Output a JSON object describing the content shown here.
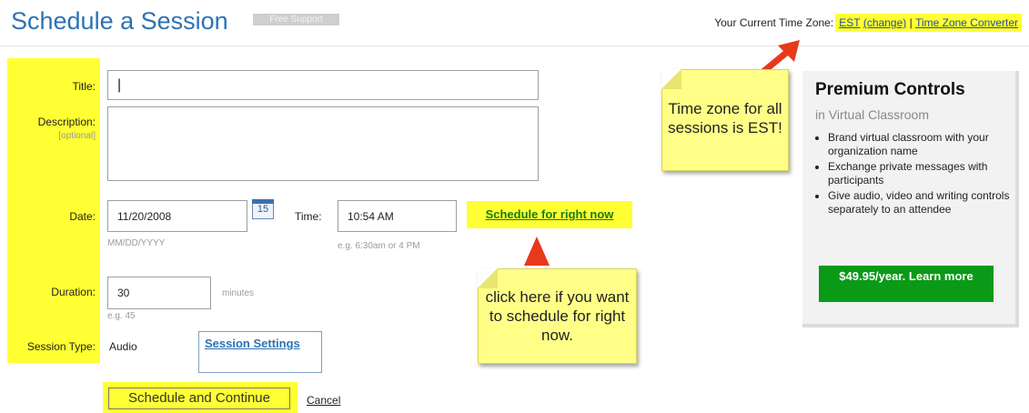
{
  "header": {
    "title": "Schedule a Session",
    "badge": "Free Support",
    "timezone_label": "Your Current Time Zone:",
    "timezone_value": "EST",
    "change_link": "(change)",
    "separator": "|",
    "converter_link": "Time Zone Converter"
  },
  "form": {
    "title_label": "Title:",
    "title_value": "|",
    "description_label": "Description:",
    "description_optional": "[optional]",
    "description_value": "",
    "date_label": "Date:",
    "date_value": "11/20/2008",
    "date_hint": "MM/DD/YYYY",
    "calendar_day": "15",
    "time_label": "Time:",
    "time_value": "10:54 AM",
    "time_hint": "e.g. 6:30am or 4 PM",
    "schedule_now_link": "Schedule for right now",
    "duration_label": "Duration:",
    "duration_value": "30",
    "duration_unit": "minutes",
    "duration_hint": "e.g. 45",
    "session_type_label": "Session Type:",
    "session_type_value": "Audio",
    "session_settings_button": "Session Settings",
    "submit_button": "Schedule and Continue",
    "cancel_link": "Cancel"
  },
  "notes": {
    "timezone_note": "Time zone for all sessions is EST!",
    "schedule_now_note": "click here if you want to schedule for right now."
  },
  "premium": {
    "title": "Premium Controls",
    "subtitle": "in Virtual Classroom",
    "features": [
      "Brand virtual classroom with your organization name",
      "Exchange private messages with participants",
      "Give audio, video and writing controls separately to an attendee"
    ],
    "cta_button": "$49.95/year. Learn more"
  },
  "colors": {
    "highlight": "#ffff33",
    "title_blue": "#2d72b4",
    "cta_green": "#0a9a17",
    "arrow_red": "#e8391a",
    "note_yellow": "#ffff88"
  }
}
